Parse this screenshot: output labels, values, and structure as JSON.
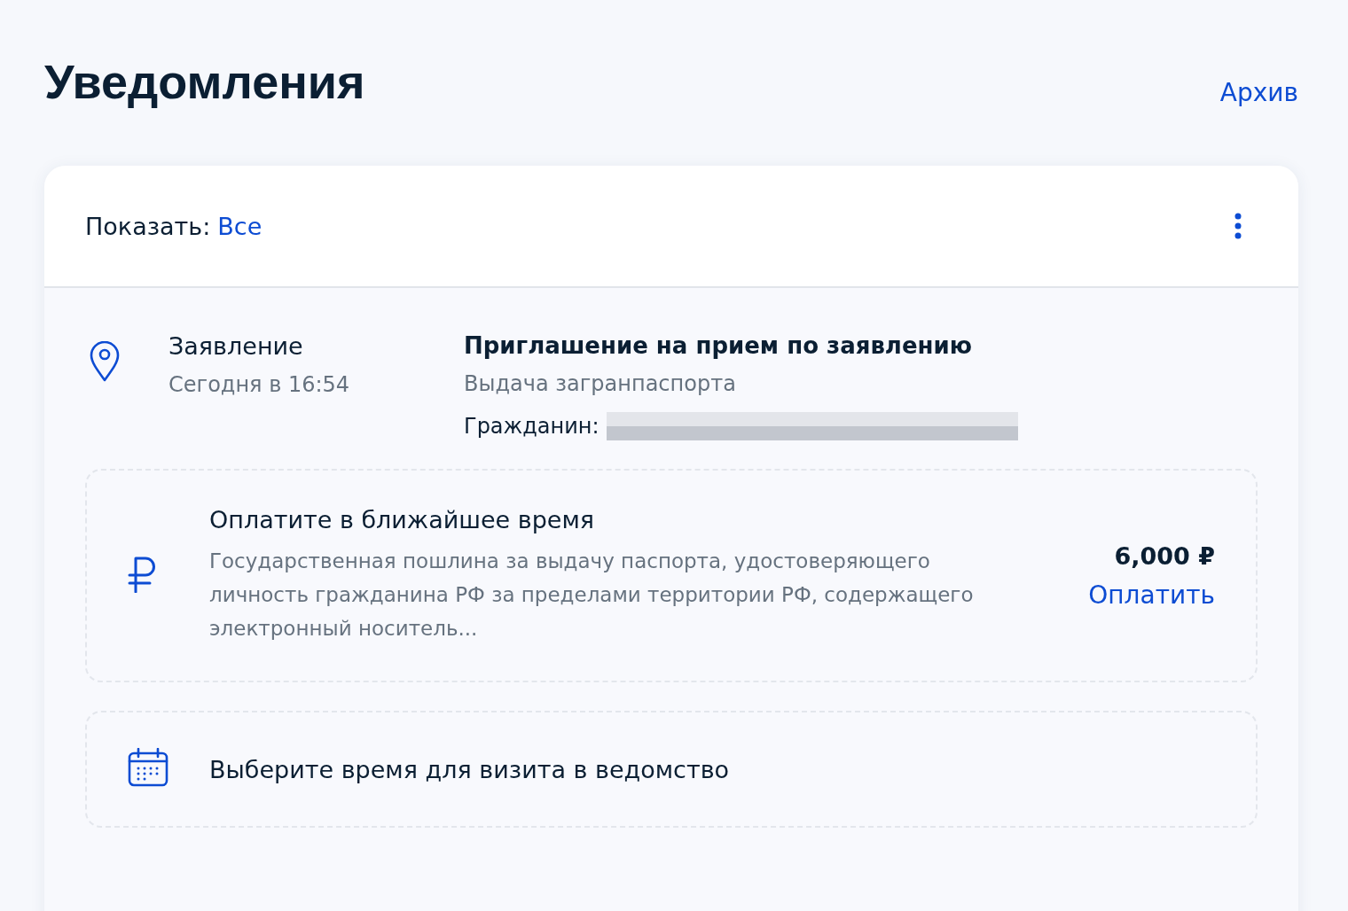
{
  "page": {
    "title": "Уведомления",
    "archive_link": "Архив"
  },
  "filter": {
    "label": "Показать:",
    "value": "Все"
  },
  "notification": {
    "category": "Заявление",
    "time": "Сегодня в 16:54",
    "title": "Приглашение на прием по заявлению",
    "subtitle": "Выдача загранпаспорта",
    "citizen_label": "Гражданин:",
    "tasks": [
      {
        "kind": "payment",
        "title": "Оплатите в ближайшее время",
        "description": "Государственная пошлина за выдачу паспорта, удостоверяющего личность гражданина РФ за пределами территории РФ, содержащего электронный носитель...",
        "amount": "6,000 ₽",
        "action": "Оплатить"
      },
      {
        "kind": "visit",
        "title": "Выберите время для визита в ведомство"
      }
    ]
  }
}
